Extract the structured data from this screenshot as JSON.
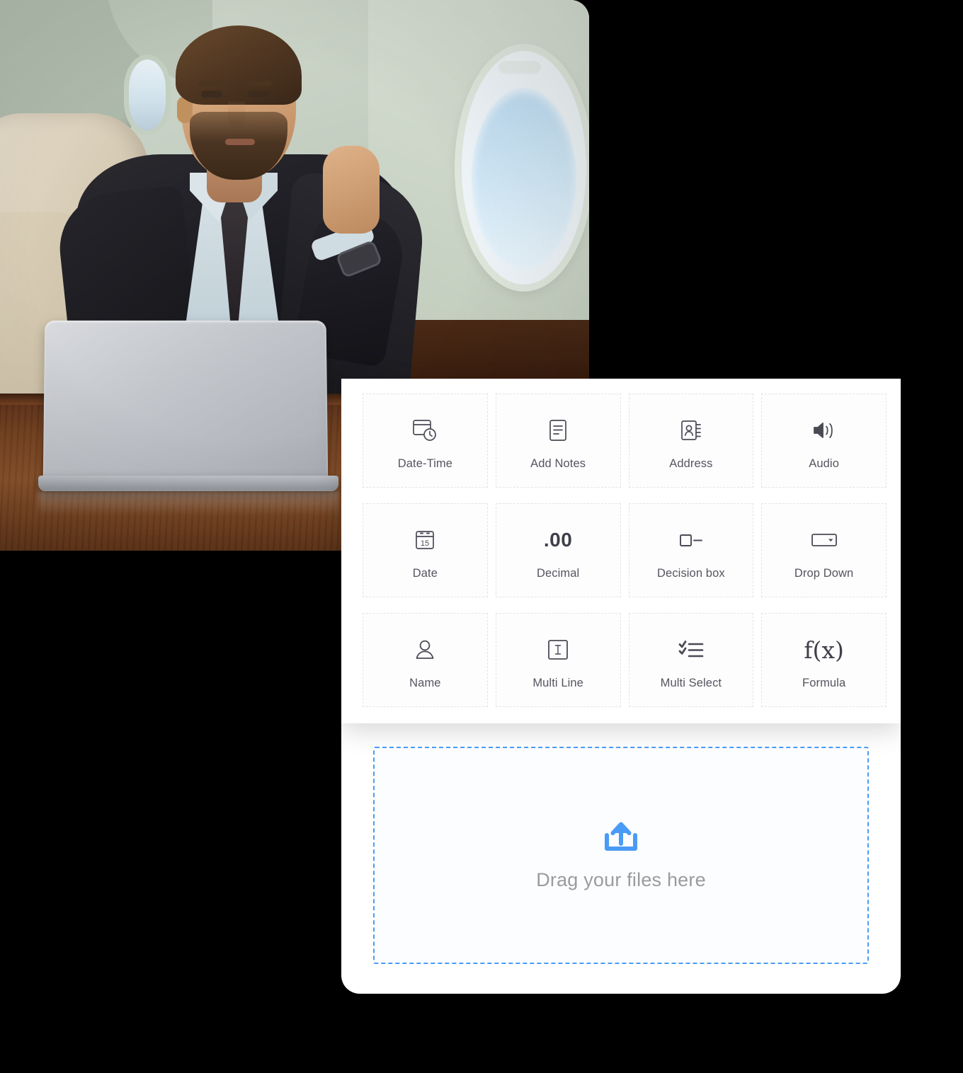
{
  "photo": {
    "alt_description": "Businessman in a suit working on a silver laptop at a wooden table inside a private jet cabin",
    "scene_elements": [
      "airplane-cabin-wall",
      "oval-window",
      "leather-seat",
      "wooden-table",
      "laptop",
      "man-in-suit"
    ]
  },
  "field_palette": {
    "items": [
      {
        "label": "Date-Time",
        "icon": "date-time-icon"
      },
      {
        "label": "Add Notes",
        "icon": "notes-icon"
      },
      {
        "label": "Address",
        "icon": "address-book-icon"
      },
      {
        "label": "Audio",
        "icon": "speaker-icon"
      },
      {
        "label": "Date",
        "icon": "calendar-icon"
      },
      {
        "label": "Decimal",
        "icon": "decimal-icon",
        "glyph": ".00"
      },
      {
        "label": "Decision box",
        "icon": "decision-box-icon"
      },
      {
        "label": "Drop Down",
        "icon": "dropdown-icon"
      },
      {
        "label": "Name",
        "icon": "person-icon"
      },
      {
        "label": "Multi Line",
        "icon": "multi-line-icon",
        "glyph": "I"
      },
      {
        "label": "Multi Select",
        "icon": "multi-select-icon"
      },
      {
        "label": "Formula",
        "icon": "formula-icon",
        "glyph": "f(x)"
      }
    ]
  },
  "dropzone": {
    "text": "Drag your files here",
    "icon": "upload-icon"
  },
  "colors": {
    "accent_blue": "#4a9bf5",
    "card_background": "#ffffff",
    "card_border_dashed": "#e2e4e8",
    "label_text": "#55555f",
    "dropzone_text": "#9b9b9e",
    "icon_stroke": "#4a4a55",
    "page_background": "#000000"
  }
}
